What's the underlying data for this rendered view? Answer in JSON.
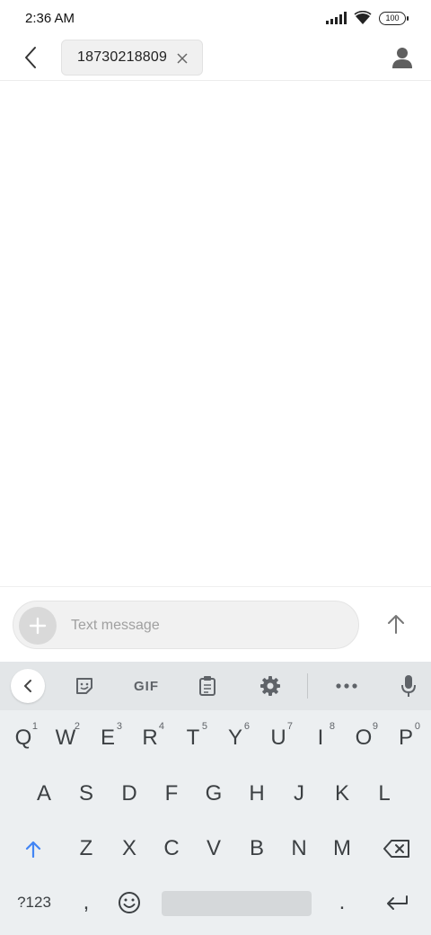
{
  "status_bar": {
    "time": "2:36 AM",
    "battery": "100"
  },
  "header": {
    "recipient": "18730218809"
  },
  "compose": {
    "placeholder": "Text message"
  },
  "keyboard": {
    "toolbar": {
      "gif_label": "GIF"
    },
    "row1": [
      {
        "label": "Q",
        "hint": "1"
      },
      {
        "label": "W",
        "hint": "2"
      },
      {
        "label": "E",
        "hint": "3"
      },
      {
        "label": "R",
        "hint": "4"
      },
      {
        "label": "T",
        "hint": "5"
      },
      {
        "label": "Y",
        "hint": "6"
      },
      {
        "label": "U",
        "hint": "7"
      },
      {
        "label": "I",
        "hint": "8"
      },
      {
        "label": "O",
        "hint": "9"
      },
      {
        "label": "P",
        "hint": "0"
      }
    ],
    "row2": [
      "A",
      "S",
      "D",
      "F",
      "G",
      "H",
      "J",
      "K",
      "L"
    ],
    "row3": [
      "Z",
      "X",
      "C",
      "V",
      "B",
      "N",
      "M"
    ],
    "symbols_label": "?123",
    "comma_label": ",",
    "period_label": "."
  },
  "colors": {
    "accent": "#4285f4",
    "keyboard_bg": "#eceff1",
    "toolbar_bg": "#e3e6e8"
  }
}
